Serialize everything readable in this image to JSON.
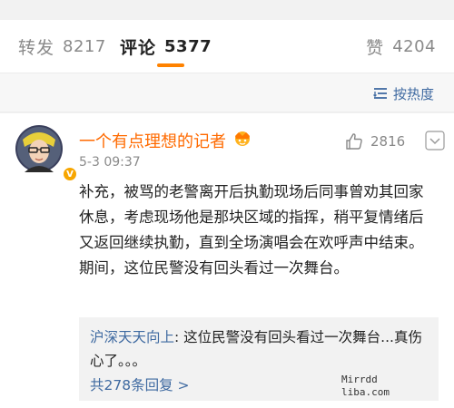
{
  "tabs": {
    "repost": {
      "label": "转发",
      "count": "8217"
    },
    "comment": {
      "label": "评论",
      "count": "5377"
    },
    "like": {
      "label": "赞",
      "count": "4204"
    }
  },
  "sort": {
    "label": "按热度"
  },
  "comment": {
    "user_name": "一个有点理想的记者",
    "time": "5-3 09:37",
    "likes": "2816",
    "verified_badge": "V",
    "body": "补充，被骂的老警离开后执勤现场后同事曾劝其回家休息，考虑现场他是那块区域的指挥，稍平复情绪后又返回继续执勤，直到全场演唱会在欢呼声中结束。期间，这位民警没有回头看过一次舞台。",
    "reply": {
      "author": "沪深天天向上",
      "text": ": 这位民警没有回头看过一次舞台...真伤心了。。。",
      "count_label": "共278条回复 >"
    }
  },
  "watermark": {
    "line1": "Mirrdd",
    "line2": "liba.com"
  },
  "colors": {
    "accent": "#ff8200",
    "username": "#ff6a00",
    "link": "#3f6aa1"
  },
  "icons": {
    "sort": "sort-lines-icon",
    "like": "thumbs-up-icon",
    "more": "chevron-down-icon",
    "badge": "crown-icon"
  }
}
